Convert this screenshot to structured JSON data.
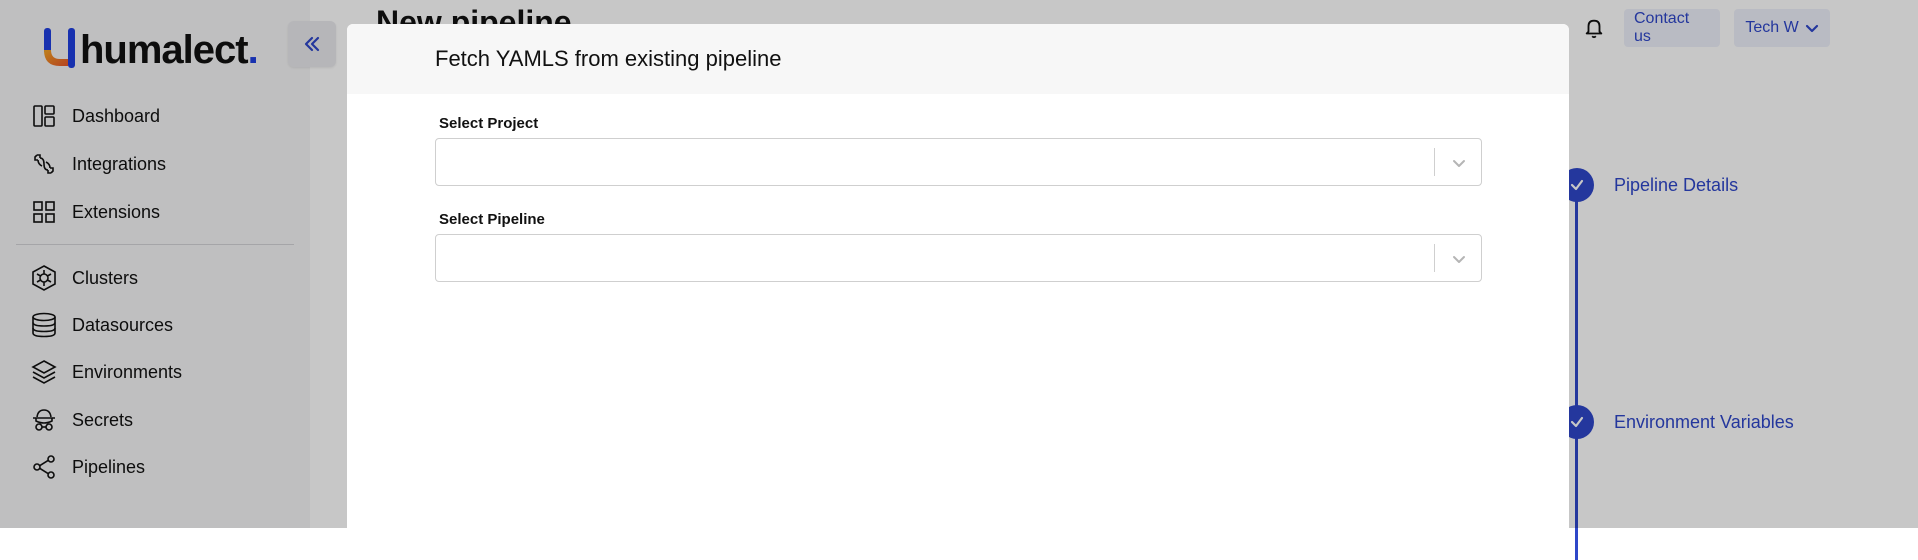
{
  "app": {
    "logo_text": "humalect",
    "logo_dot": ".",
    "page_title": "New pipeline"
  },
  "sidebar": {
    "items": [
      {
        "label": "Dashboard",
        "icon": "dashboard-icon"
      },
      {
        "label": "Integrations",
        "icon": "integrations-icon"
      },
      {
        "label": "Extensions",
        "icon": "extensions-icon"
      },
      {
        "label": "Clusters",
        "icon": "clusters-icon"
      },
      {
        "label": "Datasources",
        "icon": "datasources-icon"
      },
      {
        "label": "Environments",
        "icon": "environments-icon"
      },
      {
        "label": "Secrets",
        "icon": "secrets-icon"
      },
      {
        "label": "Pipelines",
        "icon": "pipelines-icon"
      }
    ]
  },
  "topbar": {
    "contact_label": "Contact us",
    "user_label": "Tech W"
  },
  "stepper": {
    "steps": [
      {
        "label": "Pipeline Details"
      },
      {
        "label": "Environment Variables"
      }
    ]
  },
  "modal": {
    "title": "Fetch YAMLS from existing pipeline",
    "fields": [
      {
        "label": "Select Project",
        "value": ""
      },
      {
        "label": "Select Pipeline",
        "value": ""
      }
    ]
  },
  "colors": {
    "accent": "#2f47c9",
    "logo_dot": "#1f3fe0",
    "logo_gradient": [
      "#1f3fe0",
      "#f5a623",
      "#e8562a"
    ]
  }
}
